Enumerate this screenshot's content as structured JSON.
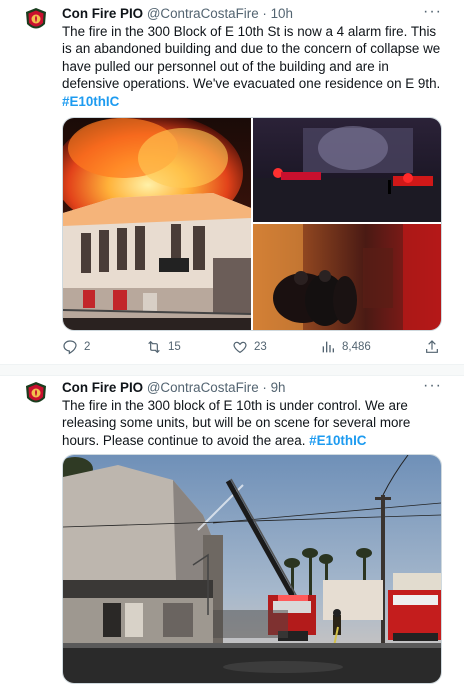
{
  "tweets": [
    {
      "name": "Con Fire PIO",
      "handle": "@ContraCostaFire",
      "sep": "·",
      "time": "10h",
      "text": "The fire in the 300 Block of E 10th St is now a 4 alarm fire.  This is an abandoned building and due to the concern of collapse we have pulled our personnel out of the building and are in defensive operations. We've evacuated one residence on E 9th.",
      "hashtag": "#E10thIC",
      "stats": {
        "replies": "2",
        "retweets": "15",
        "likes": "23",
        "views": "8,486"
      }
    },
    {
      "name": "Con Fire PIO",
      "handle": "@ContraCostaFire",
      "sep": "·",
      "time": "9h",
      "text": "The fire in the 300 block of E 10th is under control. We are releasing some units, but will be on scene for several more hours. Please continue to avoid the area. ",
      "hashtag": "#E10thIC"
    }
  ],
  "icons": {
    "more": "more-horizontal-icon",
    "reply": "reply-icon",
    "retweet": "retweet-icon",
    "like": "heart-icon",
    "views": "analytics-icon",
    "share": "share-icon"
  },
  "colors": {
    "link": "#1d9bf0",
    "muted": "#536471",
    "text": "#0f1419"
  }
}
